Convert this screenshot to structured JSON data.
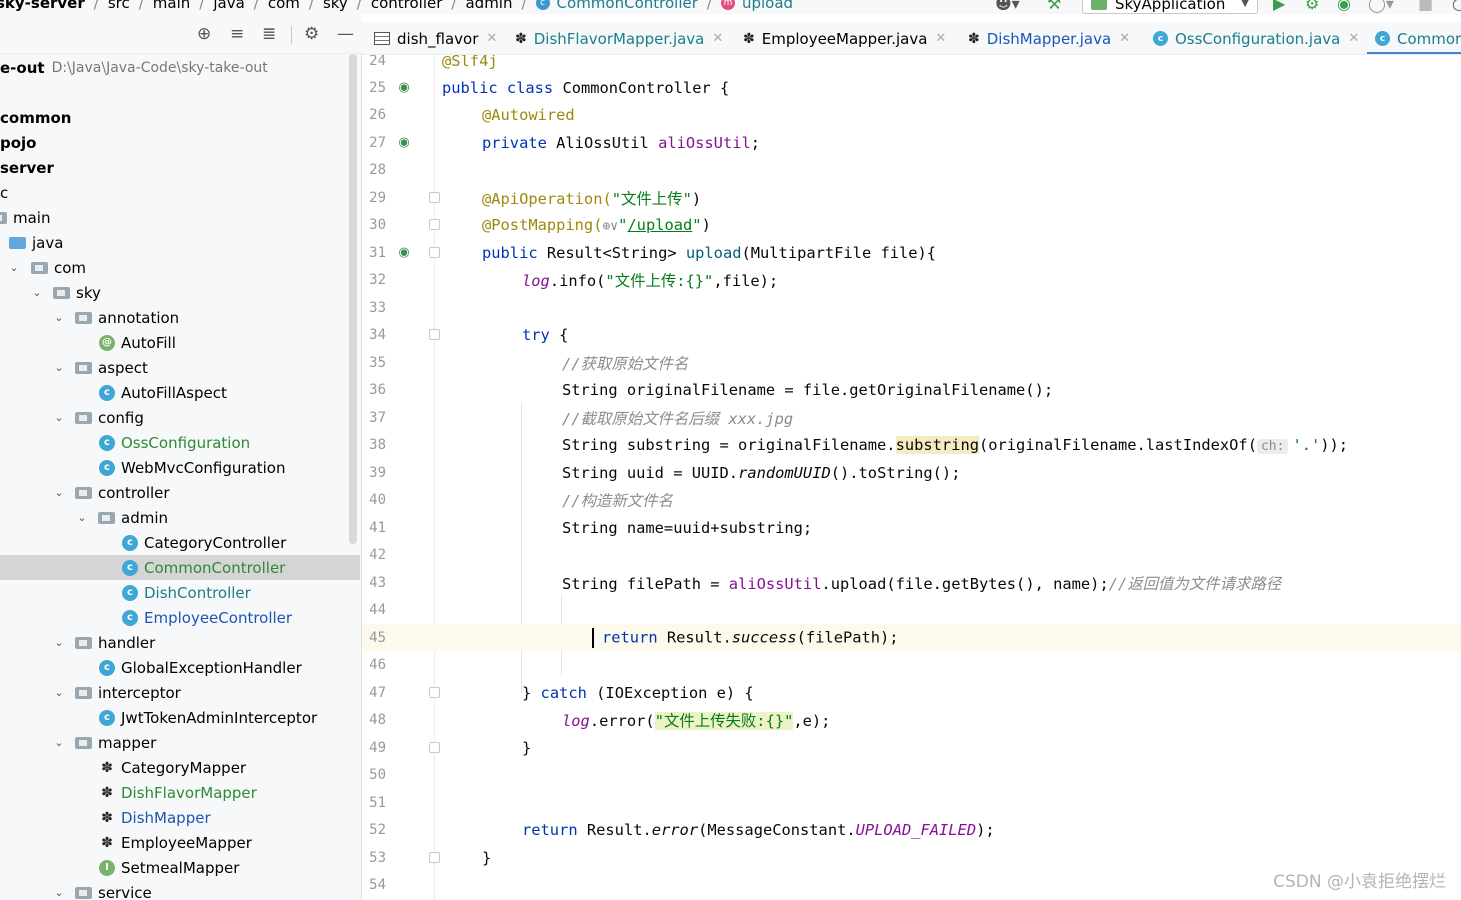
{
  "breadcrumb": {
    "items": [
      "sky-server",
      "src",
      "main",
      "java",
      "com",
      "sky",
      "controller",
      "admin",
      "CommonController",
      "upload"
    ]
  },
  "toolbar": {
    "run_config": "SkyApplication"
  },
  "project": {
    "root_label": "e-out",
    "root_path": "D:\\Java\\Java-Code\\sky-take-out",
    "rows": [
      {
        "label": "common"
      },
      {
        "label": "pojo"
      },
      {
        "label": "server"
      },
      {
        "label": "c"
      },
      {
        "label": "main"
      },
      {
        "label": "java"
      },
      {
        "label": "com"
      },
      {
        "label": "sky"
      },
      {
        "label": "annotation"
      },
      {
        "label": "AutoFill"
      },
      {
        "label": "aspect"
      },
      {
        "label": "AutoFillAspect"
      },
      {
        "label": "config"
      },
      {
        "label": "OssConfiguration"
      },
      {
        "label": "WebMvcConfiguration"
      },
      {
        "label": "controller"
      },
      {
        "label": "admin"
      },
      {
        "label": "CategoryController"
      },
      {
        "label": "CommonController"
      },
      {
        "label": "DishController"
      },
      {
        "label": "EmployeeController"
      },
      {
        "label": "handler"
      },
      {
        "label": "GlobalExceptionHandler"
      },
      {
        "label": "interceptor"
      },
      {
        "label": "JwtTokenAdminInterceptor"
      },
      {
        "label": "mapper"
      },
      {
        "label": "CategoryMapper"
      },
      {
        "label": "DishFlavorMapper"
      },
      {
        "label": "DishMapper"
      },
      {
        "label": "EmployeeMapper"
      },
      {
        "label": "SetmealMapper"
      },
      {
        "label": "service"
      }
    ]
  },
  "tabs": [
    {
      "label": "dish_flavor",
      "icon": "table-icon"
    },
    {
      "label": "DishFlavorMapper.java",
      "icon": "mybatis-icon"
    },
    {
      "label": "EmployeeMapper.java",
      "icon": "mybatis-icon"
    },
    {
      "label": "DishMapper.java",
      "icon": "mybatis-icon"
    },
    {
      "label": "OssConfiguration.java",
      "icon": "class-icon"
    },
    {
      "label": "Commor",
      "icon": "class-icon"
    }
  ],
  "editor": {
    "line_numbers": [
      "24",
      "25",
      "26",
      "27",
      "28",
      "29",
      "30",
      "31",
      "32",
      "33",
      "34",
      "35",
      "36",
      "37",
      "38",
      "39",
      "40",
      "41",
      "42",
      "43",
      "44",
      "45",
      "46",
      "47",
      "48",
      "49",
      "50",
      "51",
      "52",
      "53",
      "54"
    ],
    "lines": {
      "l24": "@Slf4j",
      "l25a": "public class ",
      "l25b": "CommonController {",
      "l26": "@Autowired",
      "l27a": "private ",
      "l27b": "AliOssUtil ",
      "l27c": "aliOssUtil",
      "l27d": ";",
      "l29a": "@ApiOperation(",
      "l29b": "\"文件上传\"",
      "l29c": ")",
      "l30a": "@PostMapping(",
      "l30b": "⊕∨",
      "l30c": "\"",
      "l30d": "/upload",
      "l30e": "\"",
      "l30f": ")",
      "l31a": "public ",
      "l31b": "Result<String> ",
      "l31c": "upload",
      "l31d": "(MultipartFile file){",
      "l32a": "log",
      "l32b": ".info(",
      "l32c": "\"文件上传:{}\"",
      "l32d": ",file);",
      "l34a": "try ",
      "l34b": "{",
      "l35": "//获取原始文件名",
      "l36": "String originalFilename = file.getOriginalFilename();",
      "l37": "//截取原始文件名后缀 xxx.jpg",
      "l38a": "String substring = originalFilename.",
      "l38b": "substring",
      "l38c": "(originalFilename.lastIndexOf(",
      "l38d": "ch:",
      "l38e": "'.'",
      "l38f": "));",
      "l39a": "String uuid = UUID.",
      "l39b": "randomUUID",
      "l39c": "().toString();",
      "l40": "//构造新文件名",
      "l41": "String name=uuid+substring;",
      "l43a": "String filePath = ",
      "l43b": "aliOssUtil",
      "l43c": ".upload(file.getBytes(), name);",
      "l43d": "//返回值为文件请求路径",
      "l45a": "return ",
      "l45b": "Result.",
      "l45c": "success",
      "l45d": "(filePath);",
      "l47a": "} ",
      "l47b": "catch ",
      "l47c": "(IOException e) {",
      "l48a": "log",
      "l48b": ".error(",
      "l48c": "\"文件上传失败:{}\"",
      "l48d": ",e);",
      "l49": "}",
      "l52a": "return ",
      "l52b": "Result.",
      "l52c": "error",
      "l52d": "(MessageConstant.",
      "l52e": "UPLOAD_FAILED",
      "l52f": ");",
      "l53": "}"
    }
  },
  "watermark": "CSDN @小袁拒绝摆烂",
  "colors": {
    "keyword": "#0033b3",
    "annotation": "#9e880d",
    "string": "#067d17",
    "comment": "#8c8c8c",
    "field": "#871094",
    "selection": "#d5d5d5",
    "active_tab_underline": "#4083c9"
  }
}
